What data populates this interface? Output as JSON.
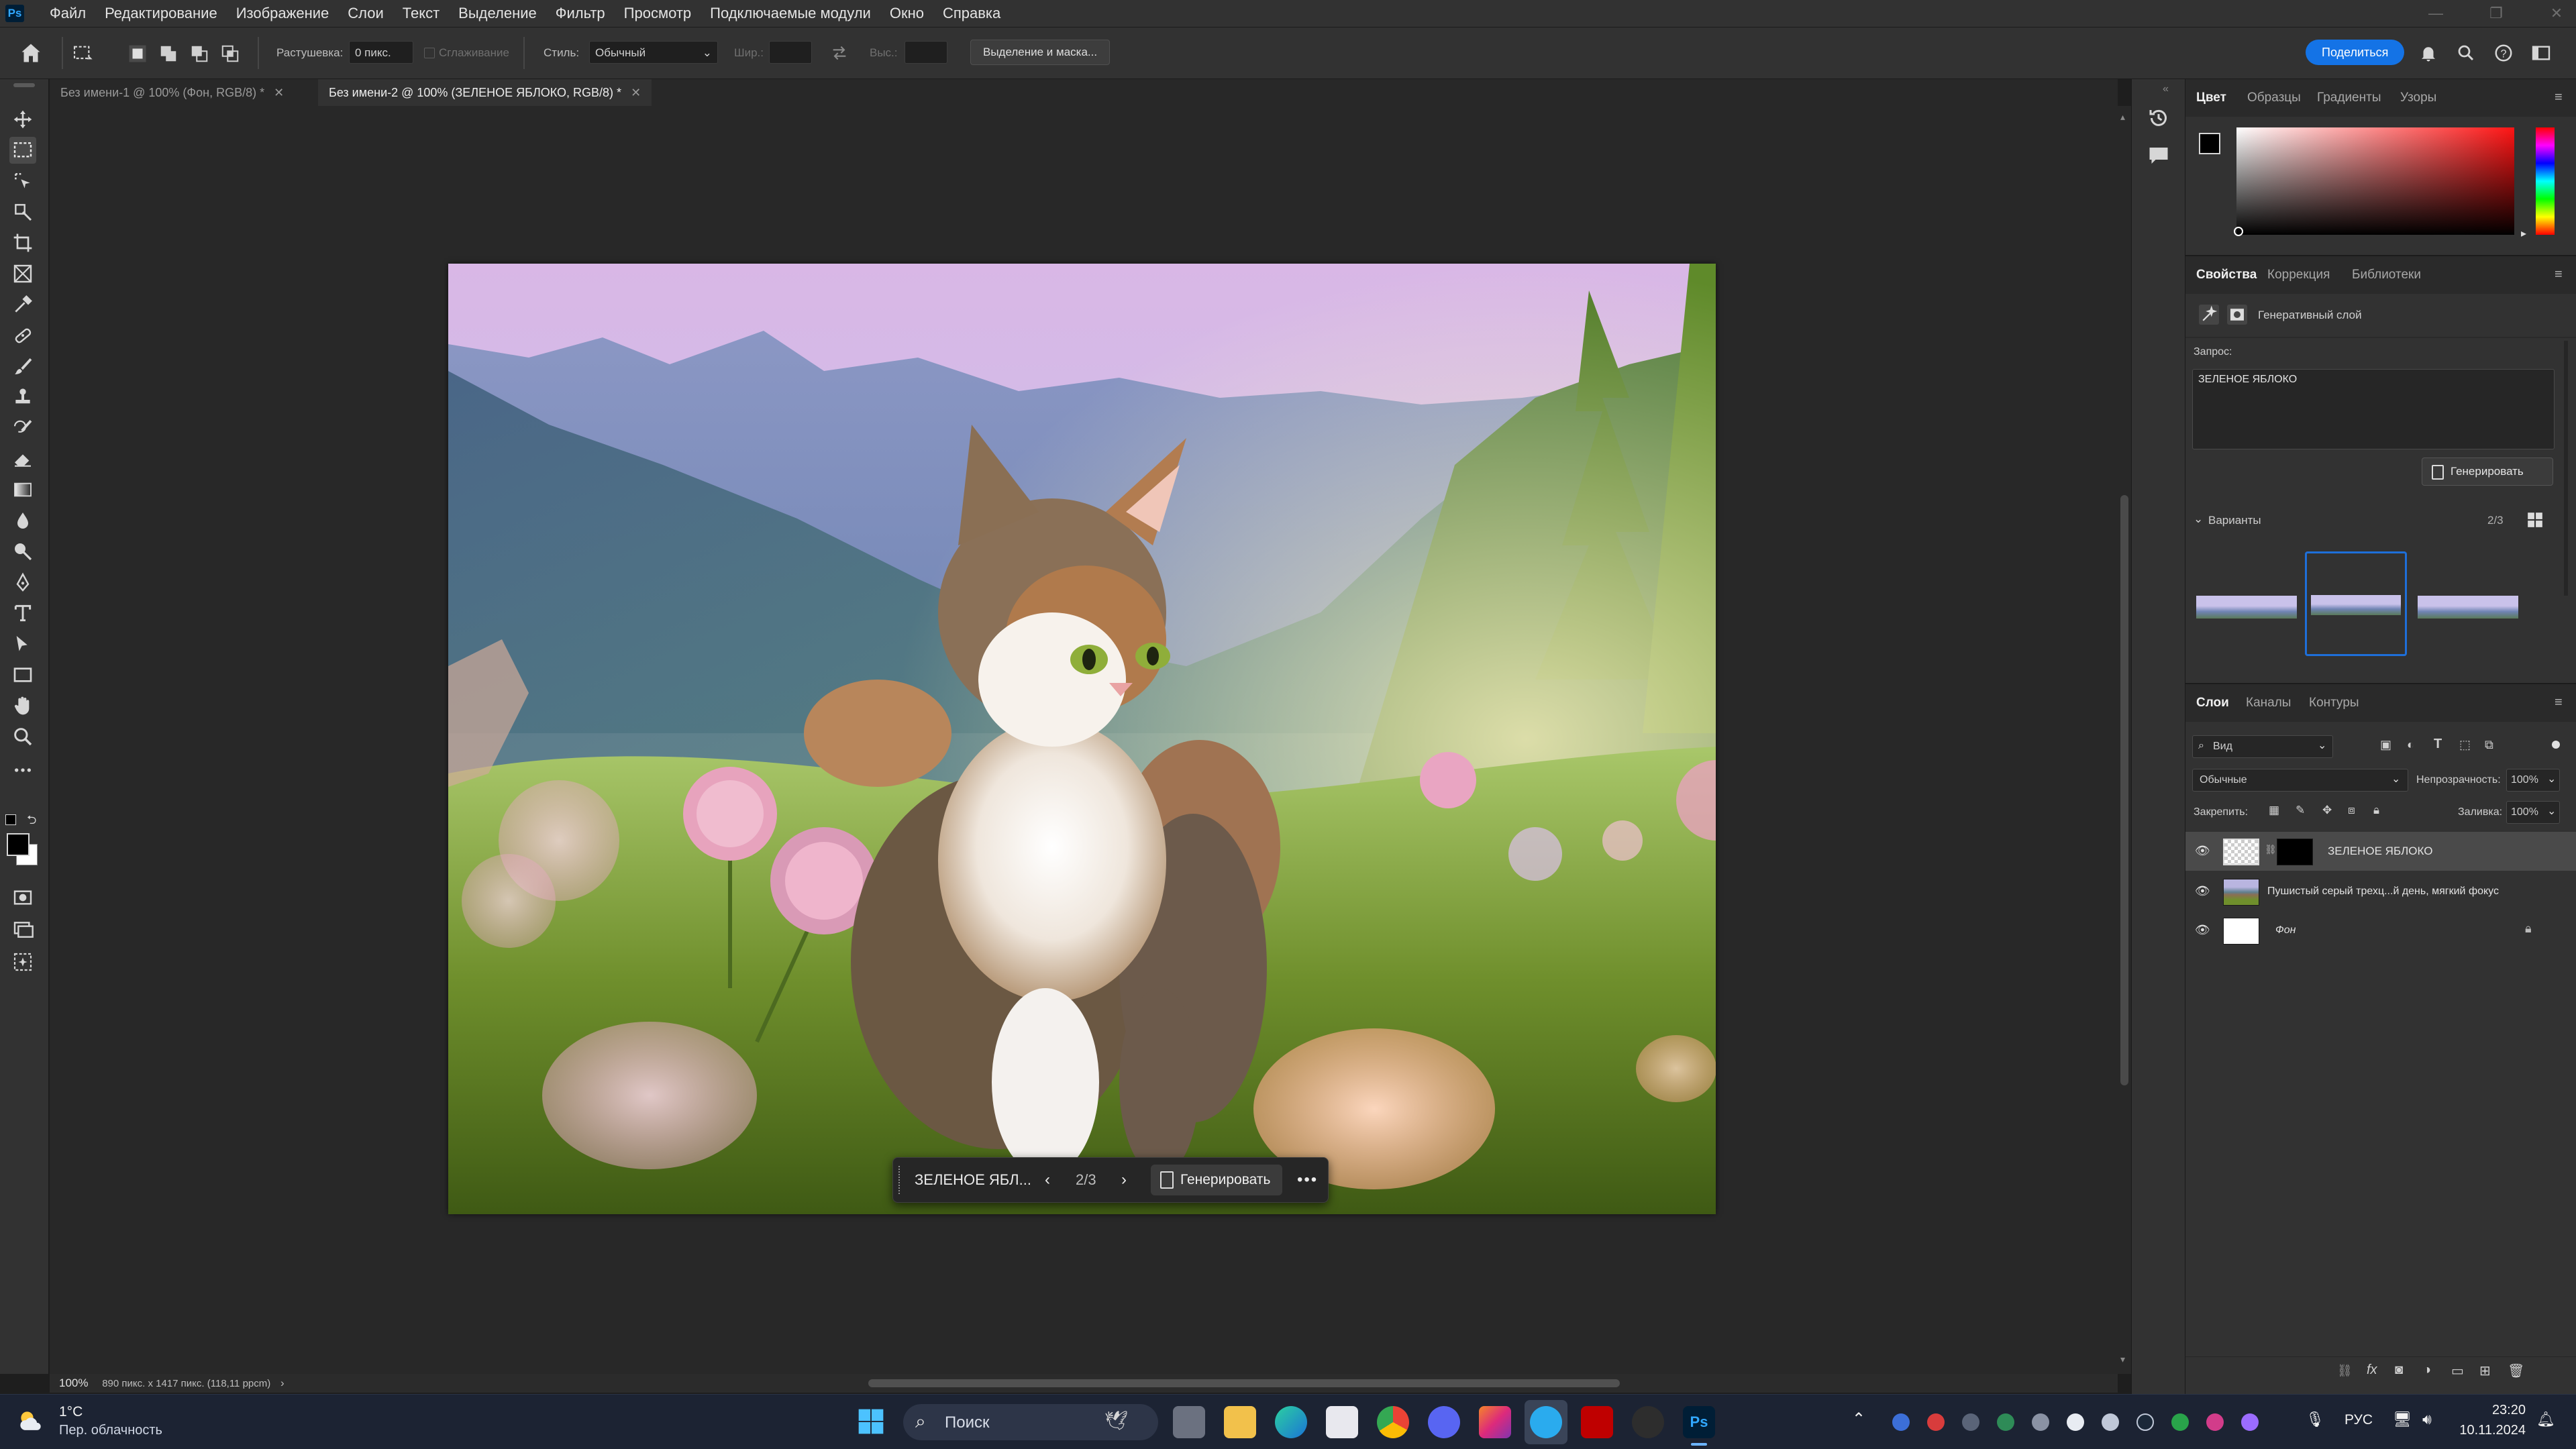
{
  "app": {
    "logo": "Ps"
  },
  "menu": [
    "Файл",
    "Редактирование",
    "Изображение",
    "Слои",
    "Текст",
    "Выделение",
    "Фильтр",
    "Просмотр",
    "Подключаемые модули",
    "Окно",
    "Справка"
  ],
  "options_bar": {
    "feather_label": "Растушевка:",
    "feather_value": "0 пикс.",
    "antialias_label": "Сглаживание",
    "style_label": "Стиль:",
    "style_value": "Обычный",
    "width_label": "Шир.:",
    "height_label": "Выс.:",
    "select_mask_button": "Выделение и маска...",
    "share_button": "Поделиться"
  },
  "doc_tabs": [
    {
      "label": "Без имени-1 @ 100% (Фон, RGB/8) *",
      "active": false
    },
    {
      "label": "Без имени-2 @ 100% (ЗЕЛЕНОЕ ЯБЛОКО, RGB/8) *",
      "active": true
    }
  ],
  "context_bar": {
    "prompt": "ЗЕЛЕНОЕ ЯБЛ...",
    "counter": "2/3",
    "generate": "Генерировать"
  },
  "status": {
    "zoom": "100%",
    "doc_size": "890 пикс. x 1417 пикс. (118,11 ppcm)"
  },
  "color_panel": {
    "tabs": [
      "Цвет",
      "Образцы",
      "Градиенты",
      "Узоры"
    ]
  },
  "properties_panel": {
    "tabs": [
      "Свойства",
      "Коррекция",
      "Библиотеки"
    ],
    "layer_type": "Генеративный слой",
    "prompt_label": "Запрос:",
    "prompt_value": "ЗЕЛЕНОЕ ЯБЛОКО",
    "generate_button": "Генерировать",
    "variants_label": "Варианты",
    "variants_count": "2/3"
  },
  "layers_panel": {
    "tabs": [
      "Слои",
      "Каналы",
      "Контуры"
    ],
    "filter_placeholder": "Вид",
    "blend_mode": "Обычные",
    "opacity_label": "Непрозрачность:",
    "opacity_value": "100%",
    "lock_label": "Закрепить:",
    "fill_label": "Заливка:",
    "fill_value": "100%",
    "layers": [
      {
        "name": "ЗЕЛЕНОЕ ЯБЛОКО",
        "selected": true
      },
      {
        "name": "Пушистый серый трехц...й день, мягкий фокус",
        "selected": false
      },
      {
        "name": "Фон",
        "selected": false
      }
    ]
  },
  "taskbar": {
    "weather_temp": "1°C",
    "weather_desc": "Пер. облачность",
    "search_placeholder": "Поиск",
    "lang": "РУС",
    "time": "23:20",
    "date": "10.11.2024"
  },
  "colors": {
    "accent": "#1473e6",
    "variant_selected": "#1e6fd9",
    "ps_blue": "#31a8ff"
  }
}
